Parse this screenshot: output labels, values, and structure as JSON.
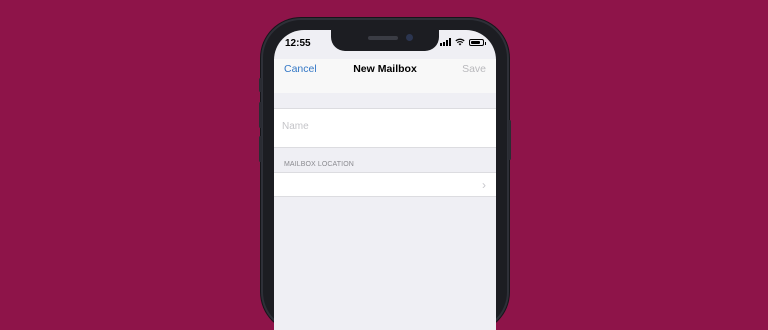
{
  "status_bar": {
    "time": "12:55",
    "battery_level": 0.85
  },
  "nav": {
    "cancel_label": "Cancel",
    "title": "New Mailbox",
    "save_label": "Save"
  },
  "name_field": {
    "placeholder": "Name",
    "value": ""
  },
  "location_section": {
    "header": "MAILBOX LOCATION",
    "chevron_glyph": "›"
  },
  "colors": {
    "background": "#8e1449",
    "accent": "#3478c6",
    "disabled": "#b9b9bd"
  }
}
